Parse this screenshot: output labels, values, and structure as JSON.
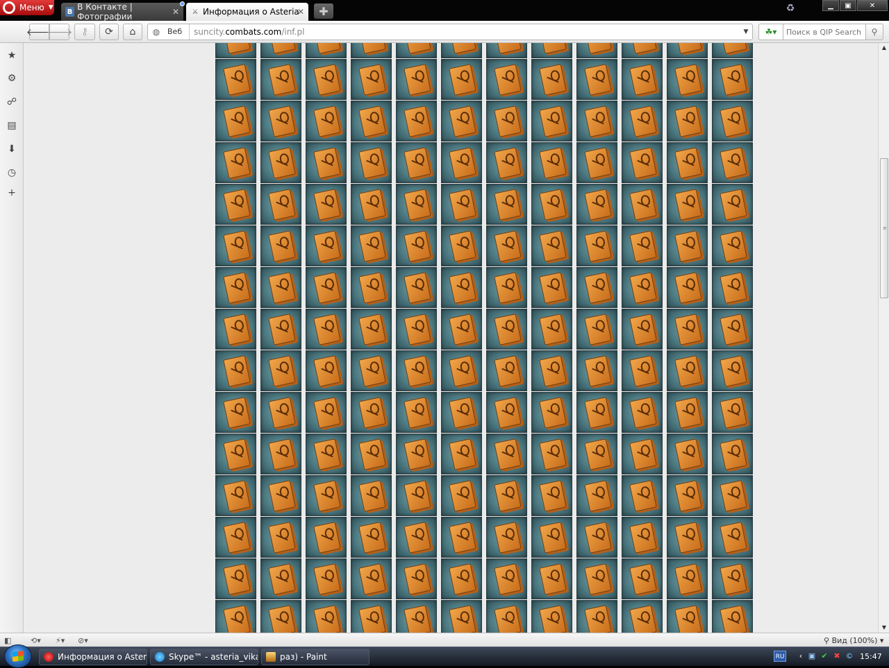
{
  "browser": {
    "menu_label": "Меню",
    "tabs": [
      {
        "title": "В Контакте | Фотографии",
        "icon": "vk-icon",
        "active": false
      },
      {
        "title": "Информация о Asteria",
        "icon": "swords-icon",
        "active": true
      }
    ]
  },
  "toolbar": {
    "address_prefix": "Веб",
    "url_domain_pre": "suncity.",
    "url_domain_main": "combats.com",
    "url_path": "/inf.pl",
    "search_placeholder": "Поиск в QIP Search"
  },
  "content": {
    "tile_image": "scroll-item-image",
    "tile_background": "#4f7c84",
    "tile_item_color": "#e08a2e",
    "columns": 12,
    "rows": 15
  },
  "statusbar": {
    "zoom_label": "Вид (100%)"
  },
  "taskbar": {
    "tasks": [
      {
        "label": "Информация о Asteri..."
      },
      {
        "label": "Skype™ - asteria_vika"
      },
      {
        "label": "раз) - Paint"
      }
    ],
    "language": "RU",
    "clock": "15:47"
  }
}
